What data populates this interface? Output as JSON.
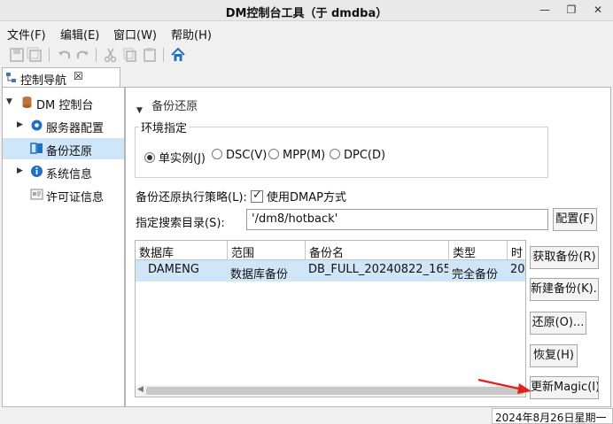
{
  "window": {
    "title": "DM控制台工具（于 dmdba）"
  },
  "menu": [
    "文件(F)",
    "编辑(E)",
    "窗口(W)",
    "帮助(H)"
  ],
  "navigator": {
    "tab_label": "控制导航",
    "items": [
      {
        "label": "DM 控制台",
        "icon": "database-icon"
      },
      {
        "label": "服务器配置",
        "icon": "gear-icon"
      },
      {
        "label": "备份还原",
        "icon": "backup-icon"
      },
      {
        "label": "系统信息",
        "icon": "info-icon"
      },
      {
        "label": "许可证信息",
        "icon": "license-icon"
      }
    ]
  },
  "main": {
    "section_title": "备份还原",
    "env_group_label": "环境指定",
    "radios": [
      "单实例(J)",
      "DSC(V)",
      "MPP(M)",
      "DPC(D)"
    ],
    "selected_radio": "单实例(J)",
    "strategy_label": "备份还原执行策略(L):",
    "dmap_checkbox_label": "使用DMAP方式",
    "dmap_checked": true,
    "search_dir_label": "指定搜索目录(S):",
    "search_dir_value": "'/dm8/hotback'",
    "config_button": "配置(F)",
    "table": {
      "columns": [
        "数据库",
        "范围",
        "备份名",
        "类型",
        "时"
      ],
      "rows": [
        [
          "DAMENG",
          "数据库备份",
          "DB_FULL_20240822_165...",
          "完全备份",
          "20"
        ]
      ]
    },
    "side_buttons": [
      "获取备份(R)",
      "新建备份(K)...",
      "还原(O)...",
      "恢复(H)",
      "更新Magic(I)"
    ]
  },
  "status_bar": {
    "datetime": "2024年8月26日星期一"
  },
  "colors": {
    "selection": "#cfe6f8",
    "arrow": "#e0241c",
    "home_icon": "#1f6fc2"
  }
}
